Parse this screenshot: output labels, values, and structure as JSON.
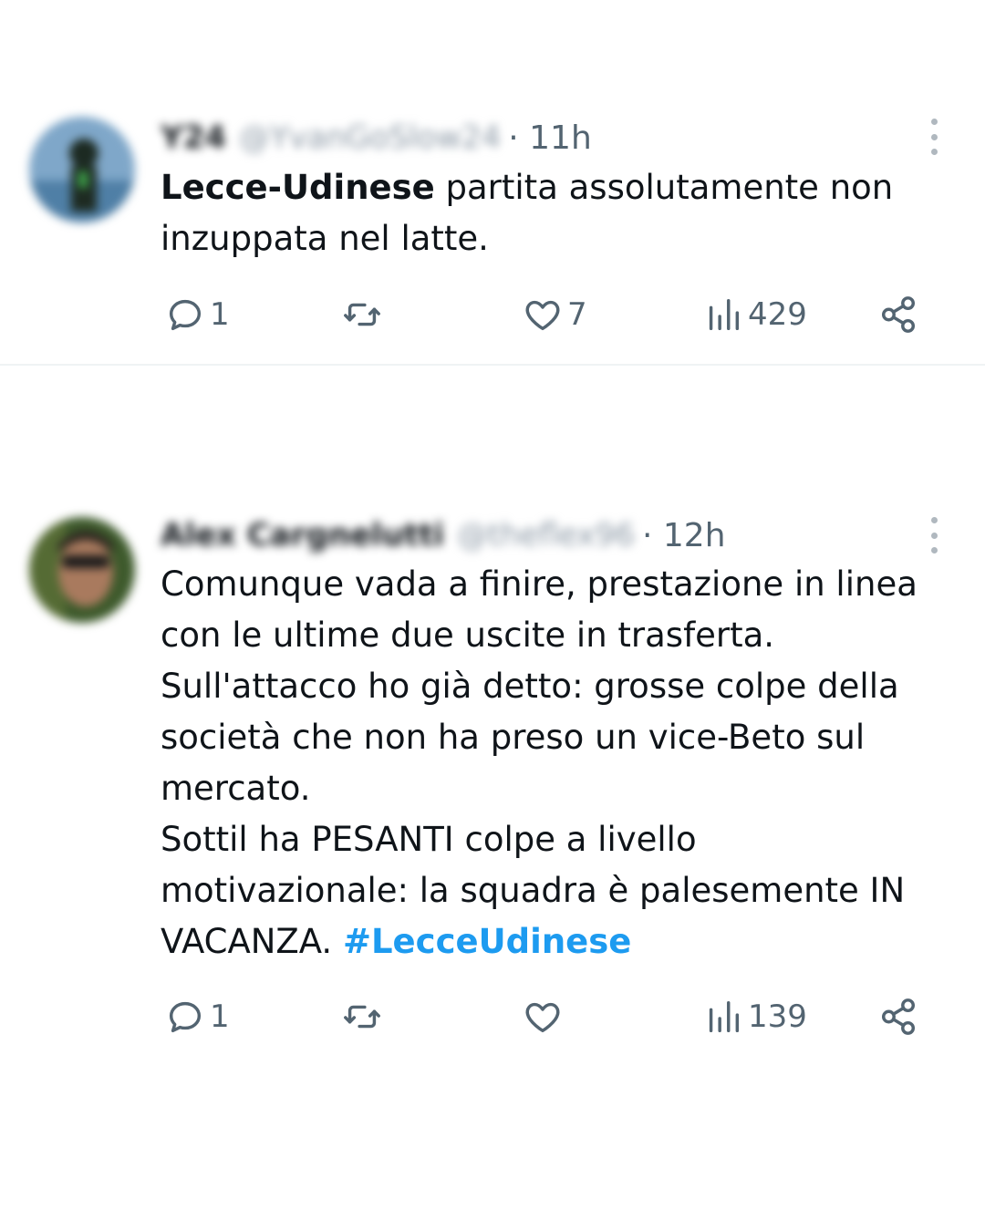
{
  "tweets": [
    {
      "author_name": "Y24",
      "author_handle": "@YvanGoSlow24",
      "time": "· 11h",
      "text_bold": "Lecce-Udinese",
      "text_rest": " partita assolutamente non inzuppata nel latte.",
      "replies": "1",
      "retweets": "",
      "likes": "7",
      "views": "429"
    },
    {
      "author_name": "Alex Cargnelutti",
      "author_handle": "@theflex96",
      "time": "· 12h",
      "lines": [
        "Comunque vada a finire, prestazione in linea con le ultime due uscite in trasferta.",
        "Sull'attacco ho già detto: grosse colpe della società che non ha preso un vice-Beto sul mercato.",
        "Sottil ha PESANTI colpe a livello motivazionale: la squadra è palesemente IN VACANZA. "
      ],
      "hashtag": "#LecceUdinese",
      "replies": "1",
      "retweets": "",
      "likes": "",
      "views": "139"
    }
  ],
  "icons": {
    "reply": "reply-icon",
    "retweet": "retweet-icon",
    "like": "heart-icon",
    "views": "views-icon",
    "share": "share-icon",
    "more": "more-vertical-icon"
  },
  "colors": {
    "text": "#0f1419",
    "secondary": "#536471",
    "hashtag": "#1d9bf0",
    "divider": "#eff3f4"
  }
}
